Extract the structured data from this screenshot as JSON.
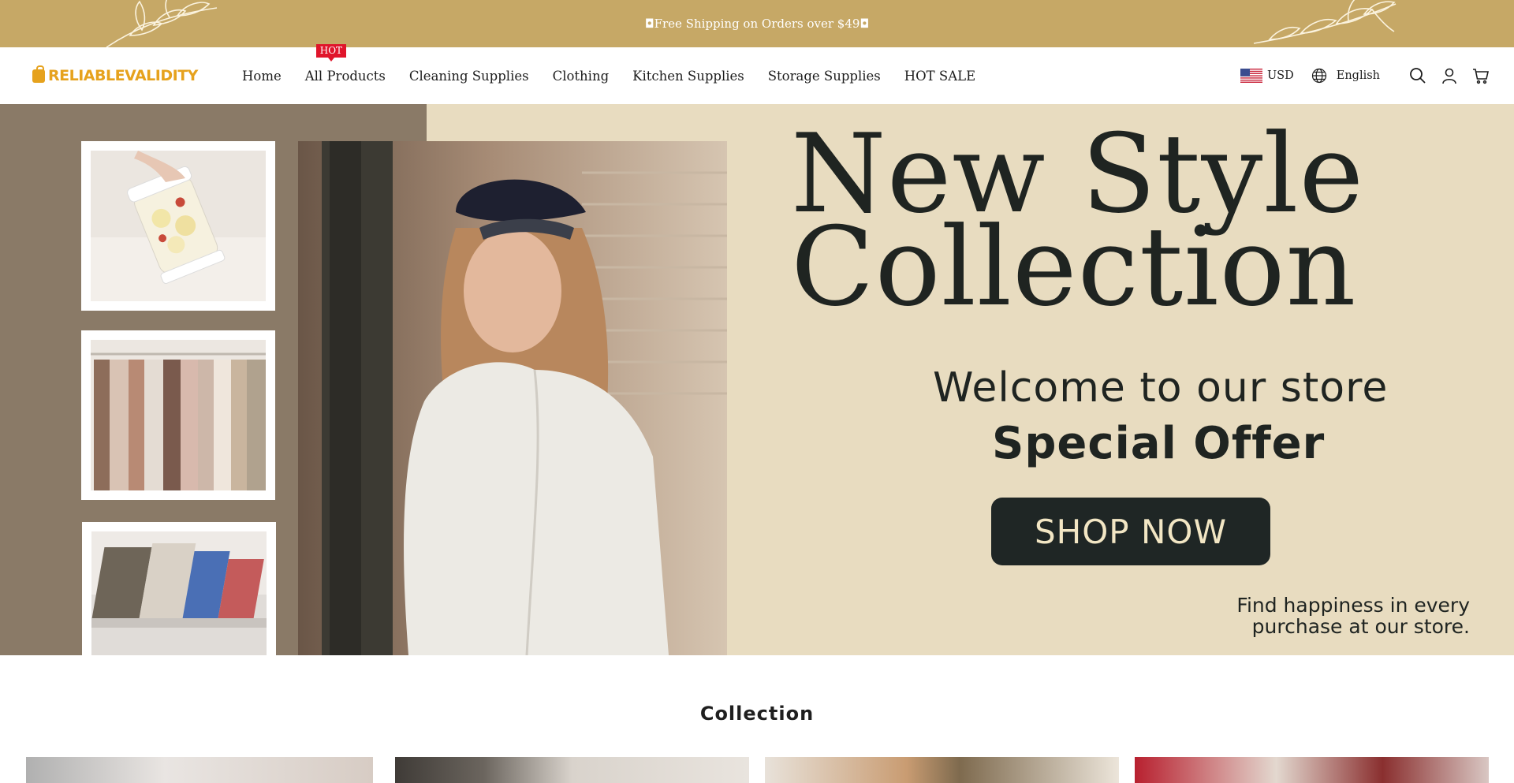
{
  "announcement": {
    "text": "◘Free Shipping on Orders over $49◘"
  },
  "logo": {
    "text": "RELIABLEVALIDITY",
    "color": "#e6a21d"
  },
  "nav": {
    "items": [
      {
        "label": "Home"
      },
      {
        "label": "All Products",
        "badge": "HOT"
      },
      {
        "label": "Cleaning Supplies"
      },
      {
        "label": "Clothing"
      },
      {
        "label": "Kitchen Supplies"
      },
      {
        "label": "Storage Supplies"
      },
      {
        "label": "HOT SALE"
      }
    ]
  },
  "header": {
    "currency": "USD",
    "language": "English",
    "icons": [
      "us-flag-icon",
      "globe-icon",
      "search-icon",
      "account-icon",
      "cart-icon"
    ]
  },
  "hero": {
    "headline_line1": "New Style",
    "headline_line2": "Collection",
    "welcome": "Welcome to our store",
    "special": "Special Offer",
    "button": "SHOP NOW",
    "tagline_line1": "Find happiness in every",
    "tagline_line2": "purchase at our store."
  },
  "collection": {
    "title": "Collection"
  },
  "colors": {
    "announcement_bg": "#c6a866",
    "hero_bg": "#e8dcc0",
    "hero_left_bg": "#8a7a67",
    "button_bg": "#1f2625",
    "hot_badge": "#e0152b"
  }
}
